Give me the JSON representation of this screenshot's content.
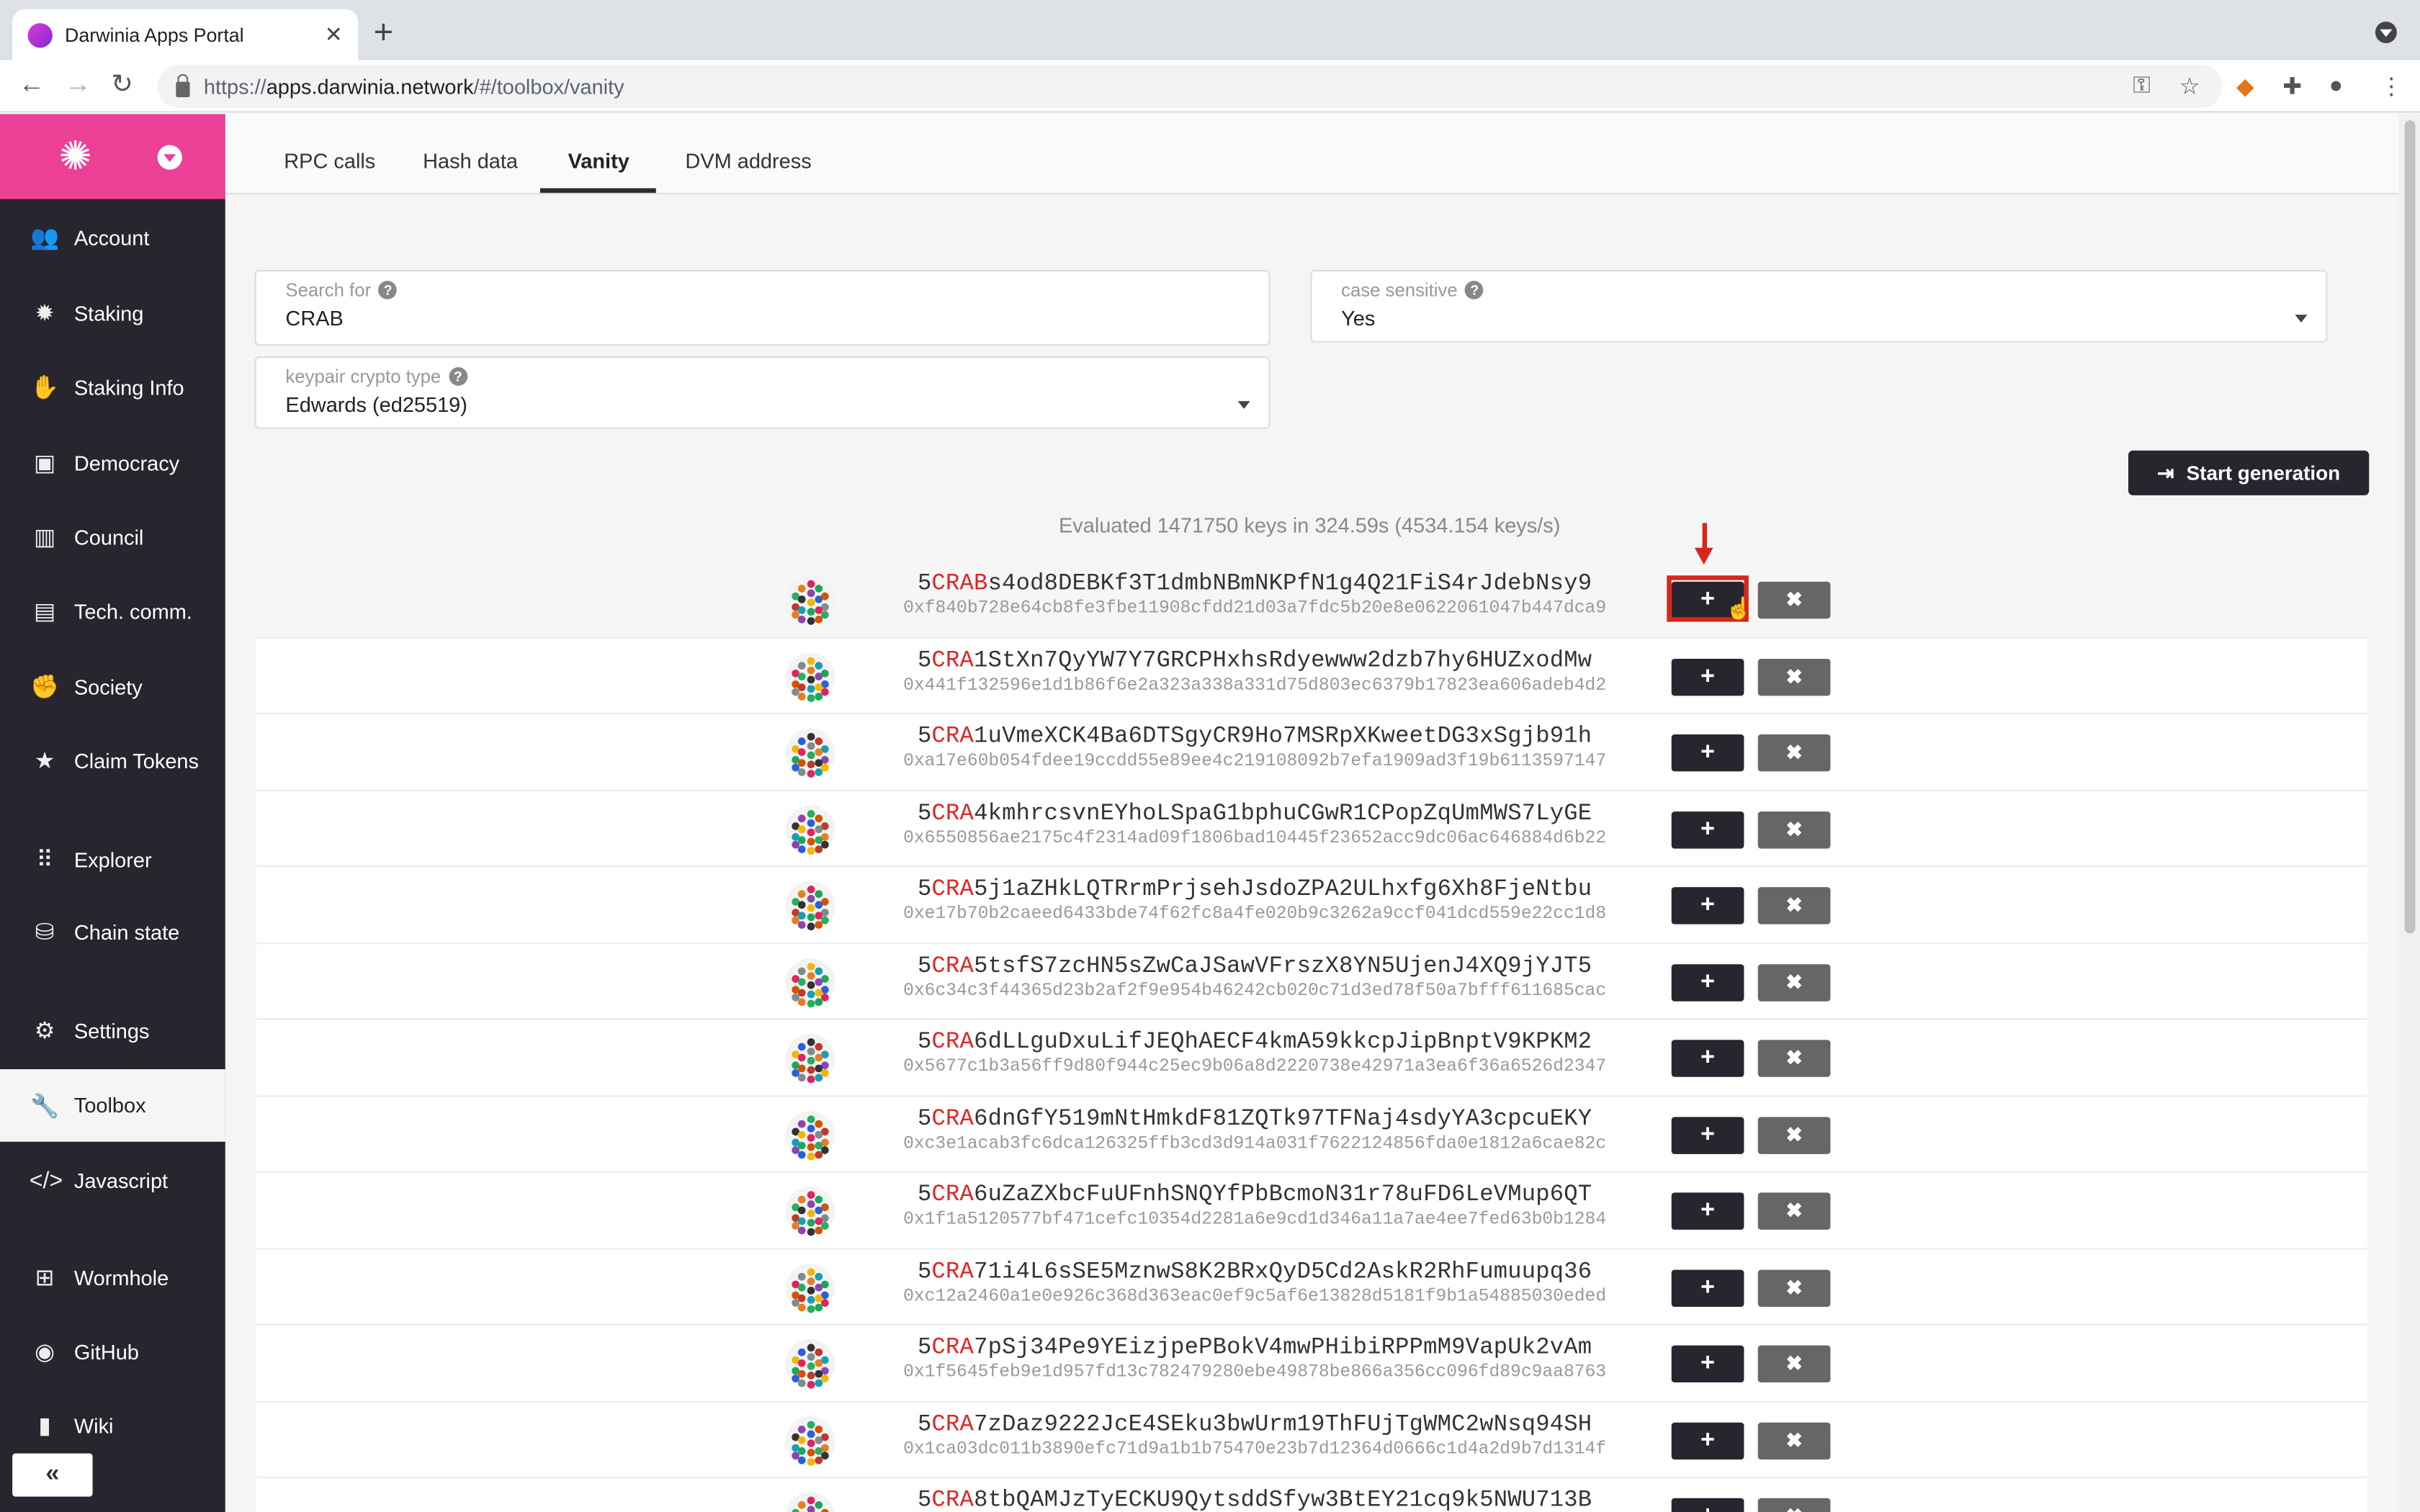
{
  "browser": {
    "tab_title": "Darwinia Apps Portal",
    "url_prefix": "https://",
    "url_host": "apps.darwinia.network",
    "url_path": "/#/toolbox/vanity"
  },
  "sidebar": {
    "items": [
      {
        "label": "Account",
        "icon": "users-icon"
      },
      {
        "label": "Staking",
        "icon": "certificate-icon"
      },
      {
        "label": "Staking Info",
        "icon": "hand-icon"
      },
      {
        "label": "Democracy",
        "icon": "calendar-check-icon"
      },
      {
        "label": "Council",
        "icon": "building-icon"
      },
      {
        "label": "Tech. comm.",
        "icon": "scroll-icon"
      },
      {
        "label": "Society",
        "icon": "handshake-icon"
      },
      {
        "label": "Claim Tokens",
        "icon": "star-icon"
      },
      {
        "label": "Explorer",
        "icon": "braille-icon"
      },
      {
        "label": "Chain state",
        "icon": "database-icon"
      },
      {
        "label": "Settings",
        "icon": "cogs-icon"
      },
      {
        "label": "Toolbox",
        "icon": "wrench-icon"
      },
      {
        "label": "Javascript",
        "icon": "code-icon"
      },
      {
        "label": "Wormhole",
        "icon": "sitemap-icon"
      },
      {
        "label": "GitHub",
        "icon": "github-icon"
      },
      {
        "label": "Wiki",
        "icon": "book-icon"
      }
    ],
    "collapse_label": "«"
  },
  "tabs": [
    "RPC calls",
    "Hash data",
    "Vanity",
    "DVM address"
  ],
  "form": {
    "search_label": "Search for",
    "search_value": "CRAB",
    "case_label": "case sensitive",
    "case_value": "Yes",
    "keypair_label": "keypair crypto type",
    "keypair_value": "Edwards (ed25519)"
  },
  "start_button": "Start generation",
  "stats": "Evaluated 1471750 keys in 324.59s (4534.154 keys/s)",
  "results": [
    {
      "match": "5CRAB",
      "rest": "s4od8DEBKf3T1dmbNBmNKPfN1g4Q21FiS4rJdebNsy9",
      "hex": "0xf840b728e64cb8fe3fbe11908cfdd21d03a7fdc5b20e8e0622061047b447dca9"
    },
    {
      "match": "5CRA",
      "rest": "1StXn7QyYW7Y7GRCPHxhsRdyewww2dzb7hy6HUZxodMw",
      "hex": "0x441f132596e1d1b86f6e2a323a338a331d75d803ec6379b17823ea606adeb4d2"
    },
    {
      "match": "5CRA",
      "rest": "1uVmeXCK4Ba6DTSgyCR9Ho7MSRpXKweetDG3xSgjb91h",
      "hex": "0xa17e60b054fdee19ccdd55e89ee4c219108092b7efa1909ad3f19b6113597147"
    },
    {
      "match": "5CRA",
      "rest": "4kmhrcsvnEYhoLSpaG1bphuCGwR1CPopZqUmMWS7LyGE",
      "hex": "0x6550856ae2175c4f2314ad09f1806bad10445f23652acc9dc06ac646884d6b22"
    },
    {
      "match": "5CRA",
      "rest": "5j1aZHkLQTRrmPrjsehJsdoZPA2ULhxfg6Xh8FjeNtbu",
      "hex": "0xe17b70b2caeed6433bde74f62fc8a4fe020b9c3262a9ccf041dcd559e22cc1d8"
    },
    {
      "match": "5CRA",
      "rest": "5tsfS7zcHN5sZwCaJSawVFrszX8YN5UjenJ4XQ9jYJT5",
      "hex": "0x6c34c3f44365d23b2af2f9e954b46242cb020c71d3ed78f50a7bfff611685cac"
    },
    {
      "match": "5CRA",
      "rest": "6dLLguDxuLifJEQhAECF4kmA59kkcpJipBnptV9KPKM2",
      "hex": "0x5677c1b3a56ff9d80f944c25ec9b06a8d2220738e42971a3ea6f36a6526d2347"
    },
    {
      "match": "5CRA",
      "rest": "6dnGfY519mNtHmkdF81ZQTk97TFNaj4sdyYA3cpcuEKY",
      "hex": "0xc3e1acab3fc6dca126325ffb3cd3d914a031f7622124856fda0e1812a6cae82c"
    },
    {
      "match": "5CRA",
      "rest": "6uZaZXbcFuUFnhSNQYfPbBcmoN31r78uFD6LeVMup6QT",
      "hex": "0x1f1a5120577bf471cefc10354d2281a6e9cd1d346a11a7ae4ee7fed63b0b1284"
    },
    {
      "match": "5CRA",
      "rest": "71i4L6sSE5MznwS8K2BRxQyD5Cd2AskR2RhFumuupq36",
      "hex": "0xc12a2460a1e0e926c368d363eac0ef9c5af6e13828d5181f9b1a54885030eded"
    },
    {
      "match": "5CRA",
      "rest": "7pSj34Pe9YEizjpePBokV4mwPHibiRPPmM9VapUk2vAm",
      "hex": "0x1f5645feb9e1d957fd13c782479280ebe49878be866a356cc096fd89c9aa8763"
    },
    {
      "match": "5CRA",
      "rest": "7zDaz9222JcE4SEku3bwUrm19ThFUjTgWMC2wNsq94SH",
      "hex": "0x1ca03dc011b3890efc71d9a1b1b75470e23b7d12364d0666c1d4a2d9b7d1314f"
    },
    {
      "match": "5CRA",
      "rest": "8tbQAMJzTyECKU9QytsddSfyw3BtEY21cq9k5NWU713B",
      "hex": ""
    }
  ]
}
